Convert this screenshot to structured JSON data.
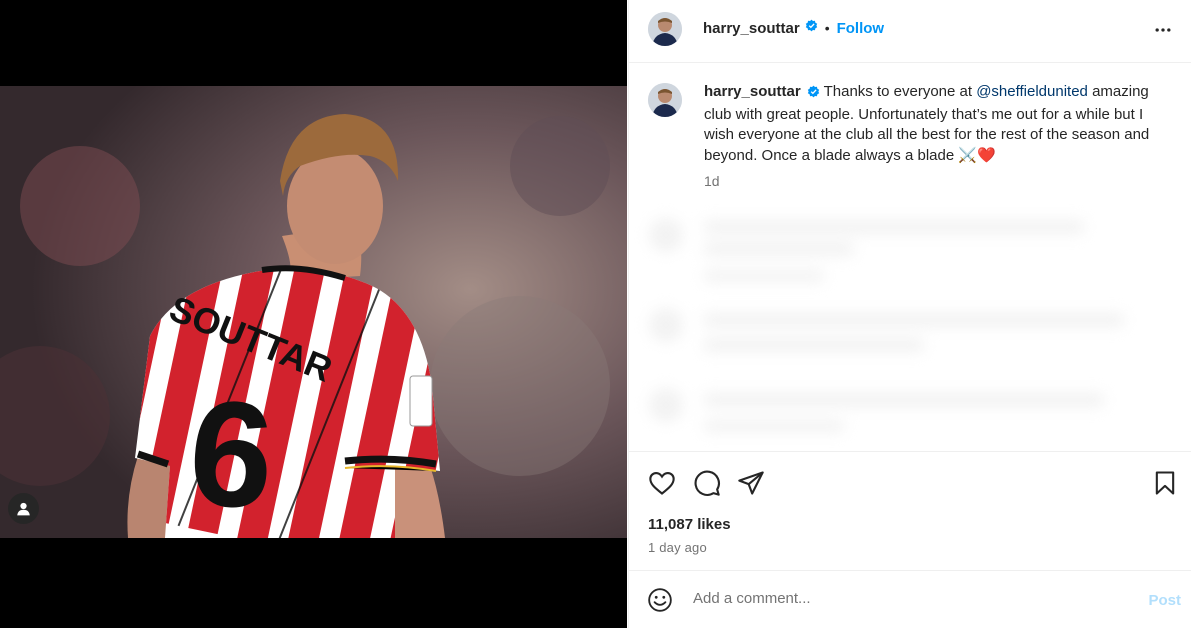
{
  "post": {
    "username": "harry_souttar",
    "follow_label": "Follow",
    "separator": "•",
    "caption_prefix": "Thanks to everyone at ",
    "caption_mention": "@sheffieldunited",
    "caption_rest": " amazing club with great people. Unfortunately that’s me out for a while but I wish everyone at the club all the best for the rest of the season and beyond. Once a blade always a blade ⚔️❤️",
    "caption_time": "1d",
    "likes": "11,087 likes",
    "posted_ago": "1 day ago"
  },
  "comment_box": {
    "placeholder": "Add a comment...",
    "post_label": "Post"
  },
  "photo": {
    "jersey_name": "SOUTTAR",
    "jersey_number": "6"
  },
  "icons": {
    "verified": "verified-badge-icon",
    "more": "more-options-icon",
    "like": "heart-icon",
    "comment": "comment-icon",
    "share": "share-icon",
    "save": "bookmark-icon",
    "emoji": "emoji-icon",
    "tags": "user-tag-icon"
  },
  "colors": {
    "accent": "#0095f6",
    "post_disabled": "#b2dffc",
    "jersey_red": "#d2222d"
  }
}
